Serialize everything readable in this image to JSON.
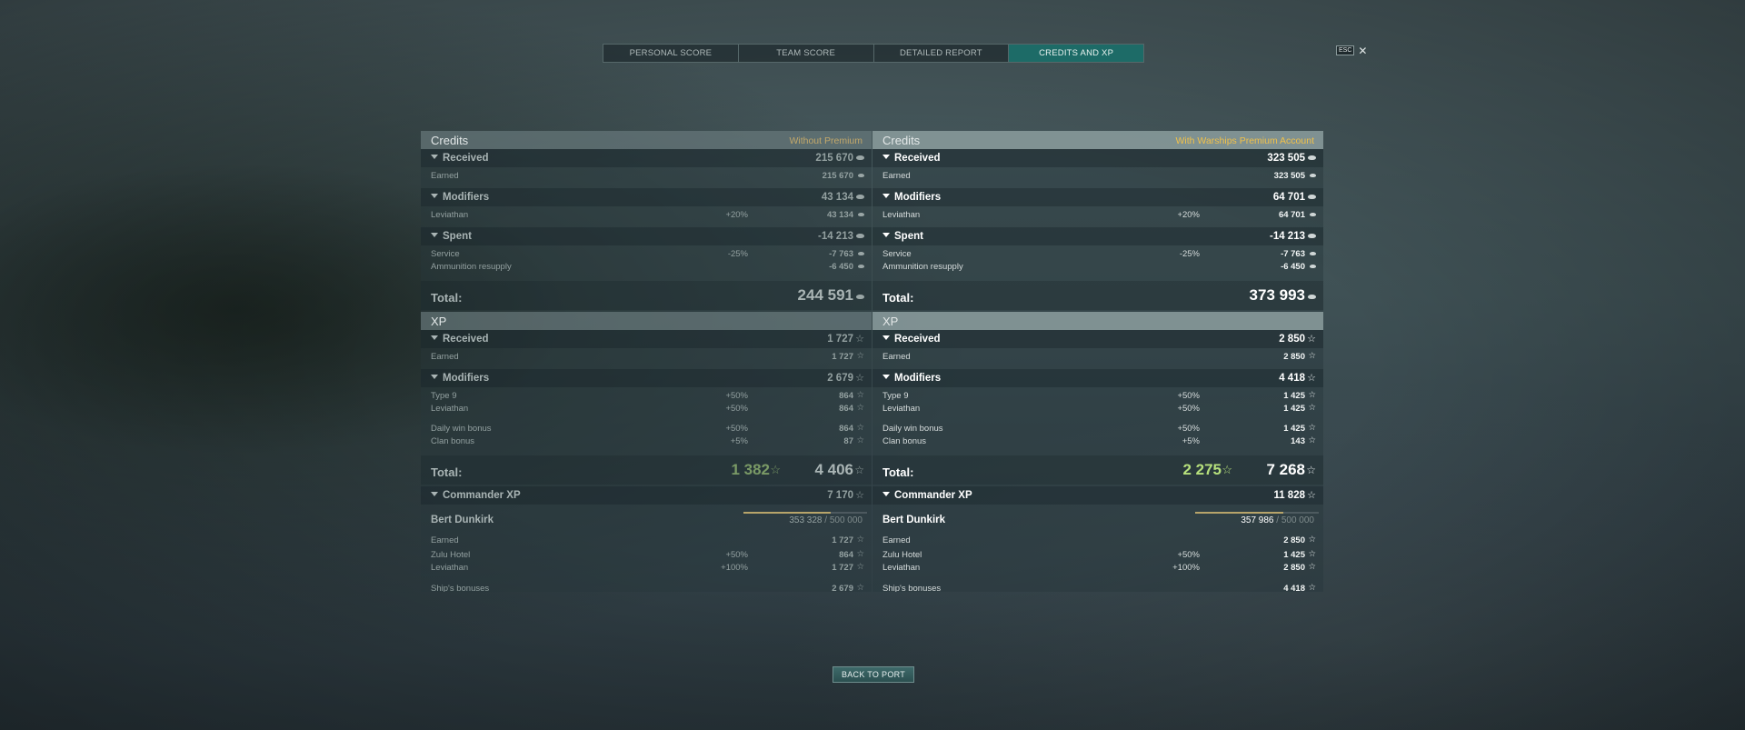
{
  "tabs": [
    {
      "label": "PERSONAL SCORE",
      "active": false
    },
    {
      "label": "TEAM SCORE",
      "active": false
    },
    {
      "label": "DETAILED REPORT",
      "active": false
    },
    {
      "label": "CREDITS AND XP",
      "active": true
    }
  ],
  "close": {
    "esc_label": "ESC",
    "close_glyph": "✕"
  },
  "icons": {
    "credits": "credit-coin-icon",
    "xp": "xp-star-icon",
    "star_glyph": "☆"
  },
  "left": {
    "credits": {
      "title": "Credits",
      "note": "Without Premium",
      "received": {
        "label": "Received",
        "value": "215 670"
      },
      "earned": {
        "label": "Earned",
        "value": "215 670"
      },
      "modifiers": {
        "label": "Modifiers",
        "value": "43 134"
      },
      "leviathan": {
        "label": "Leviathan",
        "pct": "+20%",
        "value": "43 134"
      },
      "spent": {
        "label": "Spent",
        "value": "-14 213"
      },
      "service": {
        "label": "Service",
        "pct": "-25%",
        "value": "-7 763"
      },
      "ammo": {
        "label": "Ammunition resupply",
        "value": "-6 450"
      },
      "total": {
        "label": "Total:",
        "value": "244 591"
      }
    },
    "xp": {
      "title": "XP",
      "received": {
        "label": "Received",
        "value": "1 727"
      },
      "earned": {
        "label": "Earned",
        "value": "1 727"
      },
      "modifiers": {
        "label": "Modifiers",
        "value": "2 679"
      },
      "type9": {
        "label": "Type 9",
        "pct": "+50%",
        "value": "864"
      },
      "leviathan": {
        "label": "Leviathan",
        "pct": "+50%",
        "value": "864"
      },
      "daily": {
        "label": "Daily win bonus",
        "pct": "+50%",
        "value": "864"
      },
      "clan": {
        "label": "Clan bonus",
        "pct": "+5%",
        "value": "87"
      },
      "total": {
        "label": "Total:",
        "free_value": "1 382",
        "value": "4 406"
      }
    },
    "commander": {
      "label": "Commander XP",
      "value": "7 170",
      "name": "Bert Dunkirk",
      "progress_current": "353 328",
      "progress_max": "/ 500 000",
      "progress_fraction": 0.707,
      "earned": {
        "label": "Earned",
        "value": "1 727"
      },
      "zulu": {
        "label": "Zulu Hotel",
        "pct": "+50%",
        "value": "864"
      },
      "leviathan": {
        "label": "Leviathan",
        "pct": "+100%",
        "value": "1 727"
      },
      "ship": {
        "label": "Ship's bonuses",
        "value": "2 679"
      }
    }
  },
  "right": {
    "credits": {
      "title": "Credits",
      "note": "With Warships Premium Account",
      "received": {
        "label": "Received",
        "value": "323 505"
      },
      "earned": {
        "label": "Earned",
        "value": "323 505"
      },
      "modifiers": {
        "label": "Modifiers",
        "value": "64 701"
      },
      "leviathan": {
        "label": "Leviathan",
        "pct": "+20%",
        "value": "64 701"
      },
      "spent": {
        "label": "Spent",
        "value": "-14 213"
      },
      "service": {
        "label": "Service",
        "pct": "-25%",
        "value": "-7 763"
      },
      "ammo": {
        "label": "Ammunition resupply",
        "value": "-6 450"
      },
      "total": {
        "label": "Total:",
        "value": "373 993"
      }
    },
    "xp": {
      "title": "XP",
      "received": {
        "label": "Received",
        "value": "2 850"
      },
      "earned": {
        "label": "Earned",
        "value": "2 850"
      },
      "modifiers": {
        "label": "Modifiers",
        "value": "4 418"
      },
      "type9": {
        "label": "Type 9",
        "pct": "+50%",
        "value": "1 425"
      },
      "leviathan": {
        "label": "Leviathan",
        "pct": "+50%",
        "value": "1 425"
      },
      "daily": {
        "label": "Daily win bonus",
        "pct": "+50%",
        "value": "1 425"
      },
      "clan": {
        "label": "Clan bonus",
        "pct": "+5%",
        "value": "143"
      },
      "total": {
        "label": "Total:",
        "free_value": "2 275",
        "value": "7 268"
      }
    },
    "commander": {
      "label": "Commander XP",
      "value": "11 828",
      "name": "Bert Dunkirk",
      "progress_current": "357 986",
      "progress_max": "/ 500 000",
      "progress_fraction": 0.716,
      "earned": {
        "label": "Earned",
        "value": "2 850"
      },
      "zulu": {
        "label": "Zulu Hotel",
        "pct": "+50%",
        "value": "1 425"
      },
      "leviathan": {
        "label": "Leviathan",
        "pct": "+100%",
        "value": "2 850"
      },
      "ship": {
        "label": "Ship's bonuses",
        "value": "4 418"
      }
    }
  },
  "back_button": {
    "label": "BACK TO PORT"
  }
}
